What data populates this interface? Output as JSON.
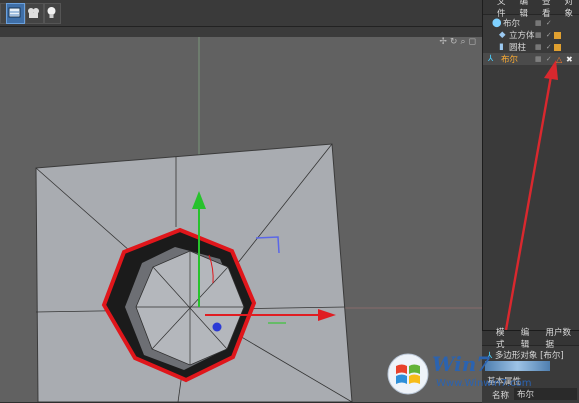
{
  "toolbar": {
    "buttons": [
      "render-view",
      "camera",
      "light"
    ]
  },
  "object_manager": {
    "menu": [
      "文件",
      "编辑",
      "查看",
      "对象"
    ],
    "objects": [
      {
        "name": "布尔",
        "indent": 0,
        "icon": "boole-icon"
      },
      {
        "name": "立方体",
        "indent": 1,
        "icon": "cube-icon"
      },
      {
        "name": "圆柱",
        "indent": 1,
        "icon": "cylinder-icon"
      },
      {
        "name": "布尔",
        "indent": 0,
        "icon": "boole-icon",
        "selected": true
      }
    ]
  },
  "attribute_manager": {
    "menu": [
      "模式",
      "编辑",
      "用户数据"
    ],
    "header": "多边形对象 [布尔]",
    "section": "基本属性",
    "field_label": "名称",
    "field_value": "布尔"
  },
  "watermark": {
    "brand": "Win7",
    "site": "Www.Winwin7.com"
  },
  "colors": {
    "selection_outline": "#e0161b",
    "annotation_arrow": "#d9282e",
    "axis_y": "#27c22c",
    "axis_x": "#e01d22",
    "axis_z": "#2c3ad6"
  }
}
